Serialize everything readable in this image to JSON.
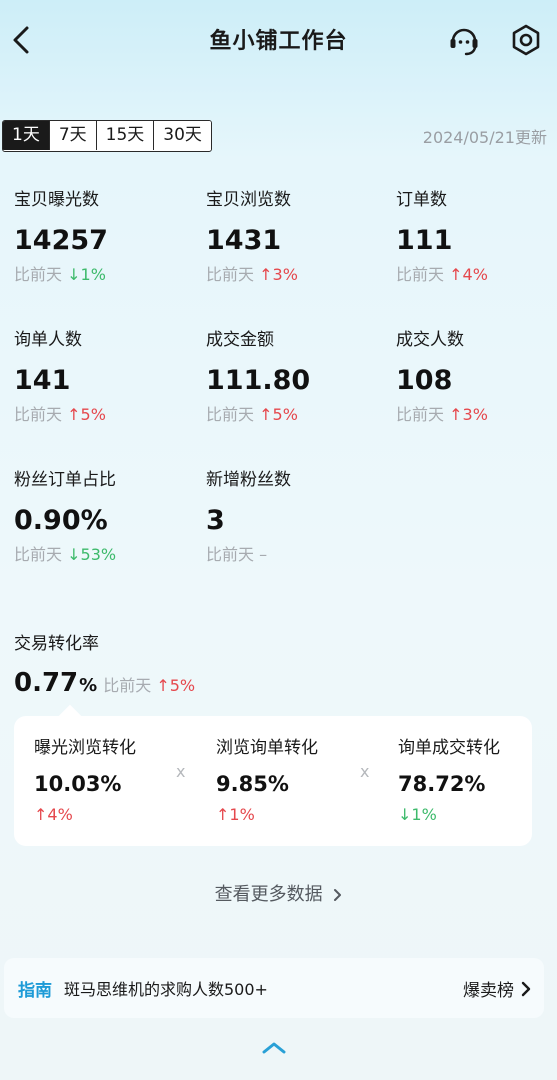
{
  "header": {
    "title": "鱼小铺工作台",
    "icons": {
      "back": "chevron-left-icon",
      "support": "customer-service-icon",
      "settings": "settings-icon"
    }
  },
  "range_tabs": [
    {
      "label": "1天",
      "active": true
    },
    {
      "label": "7天",
      "active": false
    },
    {
      "label": "15天",
      "active": false
    },
    {
      "label": "30天",
      "active": false
    }
  ],
  "update_time": "2024/05/21更新",
  "metrics": [
    {
      "label": "宝贝曝光数",
      "value": "14257",
      "cmp_prefix": "比前天",
      "trend": "down",
      "arrow": "↓",
      "change": "1%"
    },
    {
      "label": "宝贝浏览数",
      "value": "1431",
      "cmp_prefix": "比前天",
      "trend": "up",
      "arrow": "↑",
      "change": "3%"
    },
    {
      "label": "订单数",
      "value": "111",
      "cmp_prefix": "比前天",
      "trend": "up",
      "arrow": "↑",
      "change": "4%"
    },
    {
      "label": "询单人数",
      "value": "141",
      "cmp_prefix": "比前天",
      "trend": "up",
      "arrow": "↑",
      "change": "5%"
    },
    {
      "label": "成交金额",
      "value": "111.80",
      "cmp_prefix": "比前天",
      "trend": "up",
      "arrow": "↑",
      "change": "5%"
    },
    {
      "label": "成交人数",
      "value": "108",
      "cmp_prefix": "比前天",
      "trend": "up",
      "arrow": "↑",
      "change": "3%"
    },
    {
      "label": "粉丝订单占比",
      "value": "0.90%",
      "cmp_prefix": "比前天",
      "trend": "down",
      "arrow": "↓",
      "change": "53%"
    },
    {
      "label": "新增粉丝数",
      "value": "3",
      "cmp_prefix": "比前天",
      "trend": "none",
      "arrow": "",
      "change": "–"
    }
  ],
  "conversion": {
    "label": "交易转化率",
    "value": "0.77",
    "unit": "%",
    "cmp_prefix": "比前天",
    "arrow": "↑",
    "change": "5%"
  },
  "funnel": [
    {
      "label": "曝光浏览转化",
      "value": "10.03%",
      "trend": "up",
      "arrow": "↑",
      "change": "4%"
    },
    {
      "label": "浏览询单转化",
      "value": "9.85%",
      "trend": "up",
      "arrow": "↑",
      "change": "1%"
    },
    {
      "label": "询单成交转化",
      "value": "78.72%",
      "trend": "down",
      "arrow": "↓",
      "change": "1%"
    }
  ],
  "funnel_separator": "x",
  "more_data": "查看更多数据",
  "guide": {
    "tag": "指南",
    "text": "斑马思维机的求购人数500+",
    "link": "爆卖榜"
  },
  "colors": {
    "up": "#e5484d",
    "down": "#3dba6b",
    "accent": "#1e9bd7"
  }
}
